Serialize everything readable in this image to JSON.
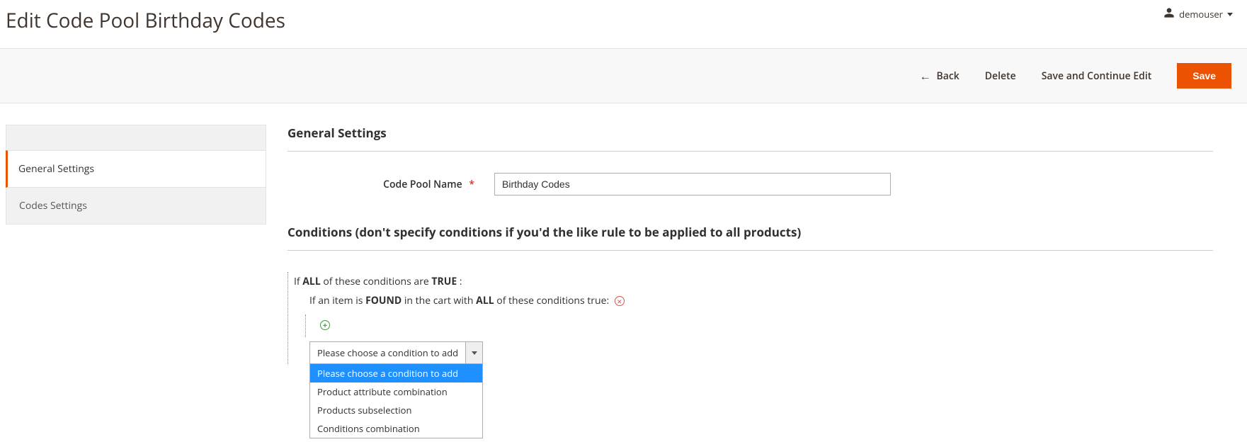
{
  "header": {
    "title": "Edit Code Pool Birthday Codes",
    "user": "demouser"
  },
  "actions": {
    "back": "Back",
    "delete": "Delete",
    "save_continue": "Save and Continue Edit",
    "save": "Save"
  },
  "sidebar": {
    "items": [
      {
        "label": "General Settings",
        "active": true
      },
      {
        "label": "Codes Settings",
        "active": false
      }
    ]
  },
  "general": {
    "section_title": "General Settings",
    "name_label": "Code Pool Name",
    "name_value": "Birthday Codes"
  },
  "conditions": {
    "section_title": "Conditions (don't specify conditions if you'd the like rule to be applied to all products)",
    "line1_prefix": "If ",
    "line1_all": "ALL",
    "line1_mid": " of these conditions are ",
    "line1_true": "TRUE",
    "line1_suffix": " :",
    "line2_prefix": "If an item is ",
    "line2_found": "FOUND",
    "line2_mid": " in the cart with ",
    "line2_all": "ALL",
    "line2_suffix": " of these conditions true: ",
    "select_current": "Please choose a condition to add",
    "select_options": [
      "Please choose a condition to add",
      "Product attribute combination",
      "Products subselection",
      "Conditions combination"
    ]
  }
}
